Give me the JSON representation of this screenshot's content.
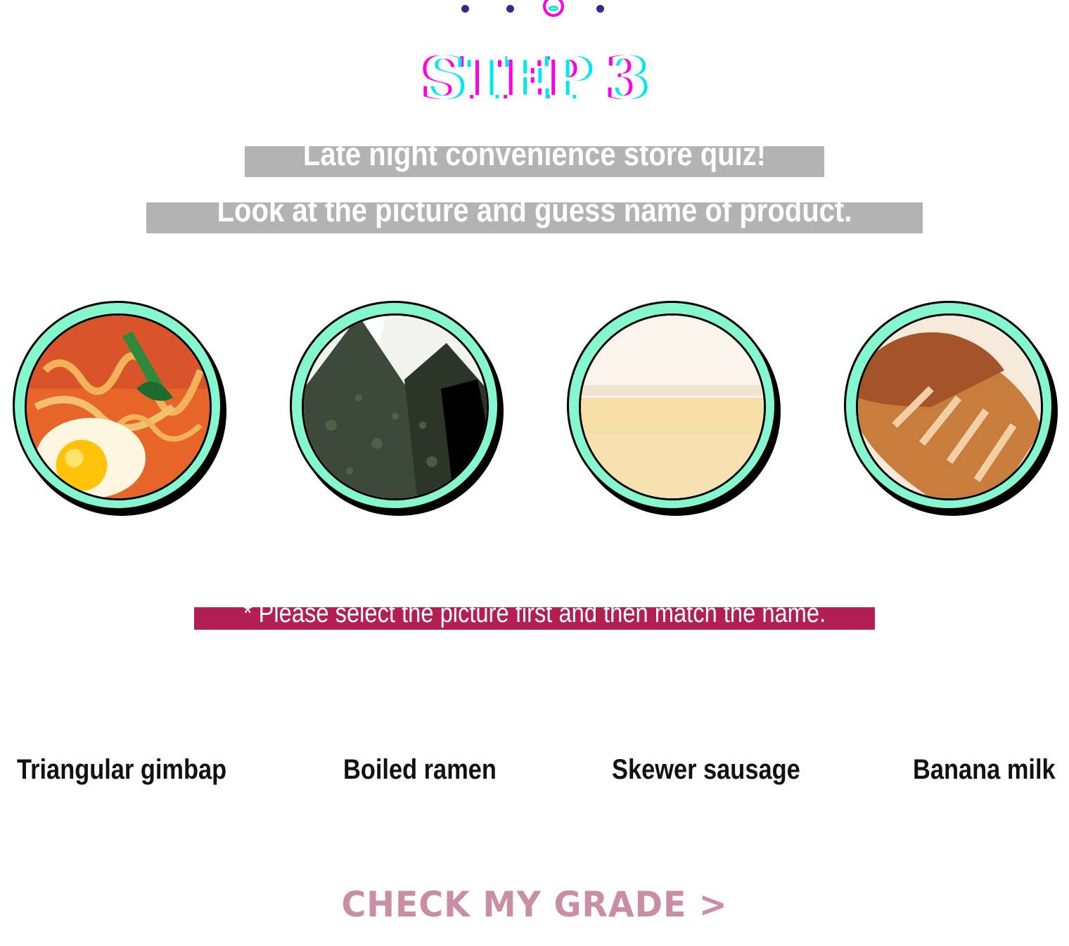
{
  "steps": {
    "count": 4,
    "active": 3
  },
  "title": "STEP 3",
  "intro": {
    "line1": "Late night convenience store quiz!",
    "line2": "Look at the picture and guess name of product."
  },
  "pictures": [
    {
      "name": "ramen-picture",
      "icon": "ramen-photo"
    },
    {
      "name": "gimbap-picture",
      "icon": "gimbap-photo"
    },
    {
      "name": "banana-milk-picture",
      "icon": "banana-milk-photo"
    },
    {
      "name": "sausage-picture",
      "icon": "sausage-photo"
    }
  ],
  "notice": "* Please select the picture first and then match the name.",
  "names": [
    "Triangular gimbap",
    "Boiled ramen",
    "Skewer sausage",
    "Banana milk"
  ],
  "cta": "CHECK MY GRADE >",
  "colors": {
    "ring": "#84f7cf",
    "band": "#b3b3b3",
    "notice": "#b31f55",
    "cta": "#c98ea4",
    "title_magenta": "#ff00e6",
    "title_cyan": "#00e8f2",
    "dot": "#2e2a8e"
  }
}
